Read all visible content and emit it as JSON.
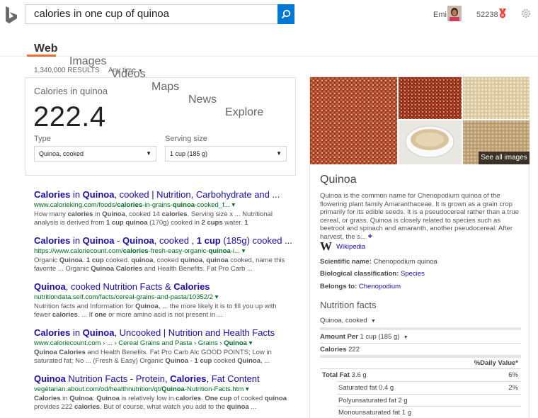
{
  "search": {
    "query": "calories in one cup of quinoa"
  },
  "header": {
    "user_name": "Emi",
    "reward_count": "52238"
  },
  "tabs": [
    {
      "label": "Web",
      "active": true
    },
    {
      "label": "Images"
    },
    {
      "label": "Videos"
    },
    {
      "label": "Maps"
    },
    {
      "label": "News"
    },
    {
      "label": "Explore"
    }
  ],
  "results_meta": {
    "count": "1,340,000 RESULTS",
    "time_filter": "Any time"
  },
  "calorie_card": {
    "title": "Calories in quinoa",
    "value": "222.4",
    "type_label": "Type",
    "type_value": "Quinoa, cooked",
    "serving_label": "Serving size",
    "serving_value": "1 cup (185 g)"
  },
  "results": [
    {
      "title": "<b>Calories</b> in <b>Quinoa</b>, cooked | Nutrition, Carbohydrate and ...",
      "url": "www.calorieking.com/foods/<b>calories</b>-in-grains-<b>quinoa</b>-cooked_f... ▾",
      "snippet": "How many <b>calories</b> in <b>Quinoa</b>, cooked 14 <b>calories</b>. Serving size x ... Nutritional analysis is derived from <b>1 cup quinoa</b> (170g) cooked in <b>2 cups</b> water. <b>1</b>"
    },
    {
      "title": "<b>Calories</b> in <b>Quinoa</b> - <b>Quinoa</b>, cooked , <b>1 cup</b> (185g) cooked ...",
      "url": "https://www.caloriecount.com/<b>calories</b>-fresh-easy-organic-<b>quinoa</b>-i... ▾",
      "snippet": "Organic <b>Quinoa</b>. <b>1 cup</b> cooked. <b>quinoa</b>, cooked <b>quinoa</b>, <b>quinoa</b> cooked, name this favorite ... Organic <b>Quinoa Calories</b> and Health Benefits. Fat Pro Carb ..."
    },
    {
      "title": "<b>Quinoa</b>, cooked Nutrition Facts &amp; <b>Calories</b>",
      "url": "nutritiondata.self.com/facts/cereal-grains-and-pasta/10352/2 ▾",
      "snippet": "Nutrition facts and Information for <b>Quinoa</b>, ... the more likely it is to fill you up with fewer <b>calories</b>. ... If <b>one</b> or more amino acid is not present in ..."
    },
    {
      "title": "<b>Calories</b> in <b>Quinoa</b>, Uncooked | Nutrition and Health Facts",
      "url": "www.caloriecount.com › ... › Cereal Grains and Pasta › Grains › <b>Quinoa</b> ▾",
      "snippet": "<b>Quinoa Calories</b> and Health Benefits. Fat Pro Carb Alc GOOD POINTS; Low in saturated fat; No ... (Fresh &amp; Easy) Organic <b>Quinoa</b> - <b>1 cup</b> cooked <b>Quinoa</b>, ..."
    },
    {
      "title": "<b>Quinoa</b> Nutrition Facts - Protein, <b>Calories</b>, Fat Content",
      "url": "vegetarian.about.com/od/healthnutrition/qt/<b>Quinoa</b>-Nutrition-Facts.htm ▾",
      "snippet": "<b>Calories</b> in <b>Quinoa</b>: <b>Quinoa</b> is relatively low in <b>calories</b>. <b>One cup</b> of cooked <b>quinoa</b> provides 222 <b>calories</b>. But of course, what watch you add to the <b>quinoa</b> ..."
    }
  ],
  "knowledge_panel": {
    "see_all_images": "See all images",
    "title": "Quinoa",
    "description": "Quinoa is the common name for Chenopodium quinoa of the flowering plant family Amaranthaceae. It is grown as a grain crop primarily for its edible seeds. It is a pseudocereal rather than a true cereal, or grass. Quinoa is closely related to species such as beetroot and spinach and amaranth, another pseudocereal. After harvest, the s...",
    "more": "+",
    "wikipedia": "Wikipedia",
    "facts": [
      {
        "label": "Scientific name:",
        "value": "Chenopodium quinoa",
        "link": false
      },
      {
        "label": "Biological classification:",
        "value": "Species",
        "link": true
      },
      {
        "label": "Belongs to:",
        "value": "Chenopodium",
        "link": true
      }
    ],
    "nutrition": {
      "title": "Nutrition facts",
      "type": "Quinoa, cooked",
      "amount_per_label": "Amount Per",
      "amount_per_value": "1 cup (185 g)",
      "calories_label": "Calories",
      "calories_value": "222",
      "dv_header": "%Daily Value*",
      "rows": [
        {
          "label": "Total Fat",
          "value": "3.6 g",
          "dv": "6%",
          "bold": true,
          "indent": false
        },
        {
          "label": "Saturated fat",
          "value": "0.4 g",
          "dv": "2%",
          "bold": false,
          "indent": true
        },
        {
          "label": "Polyunsaturated fat",
          "value": "2 g",
          "dv": "",
          "bold": false,
          "indent": true
        },
        {
          "label": "Monounsaturated fat",
          "value": "1 g",
          "dv": "",
          "bold": false,
          "indent": true
        }
      ]
    }
  },
  "colors": {
    "link": "#1a0dab",
    "url": "#006d21",
    "accent": "#ef6b2e",
    "search_button": "#0078d7"
  }
}
